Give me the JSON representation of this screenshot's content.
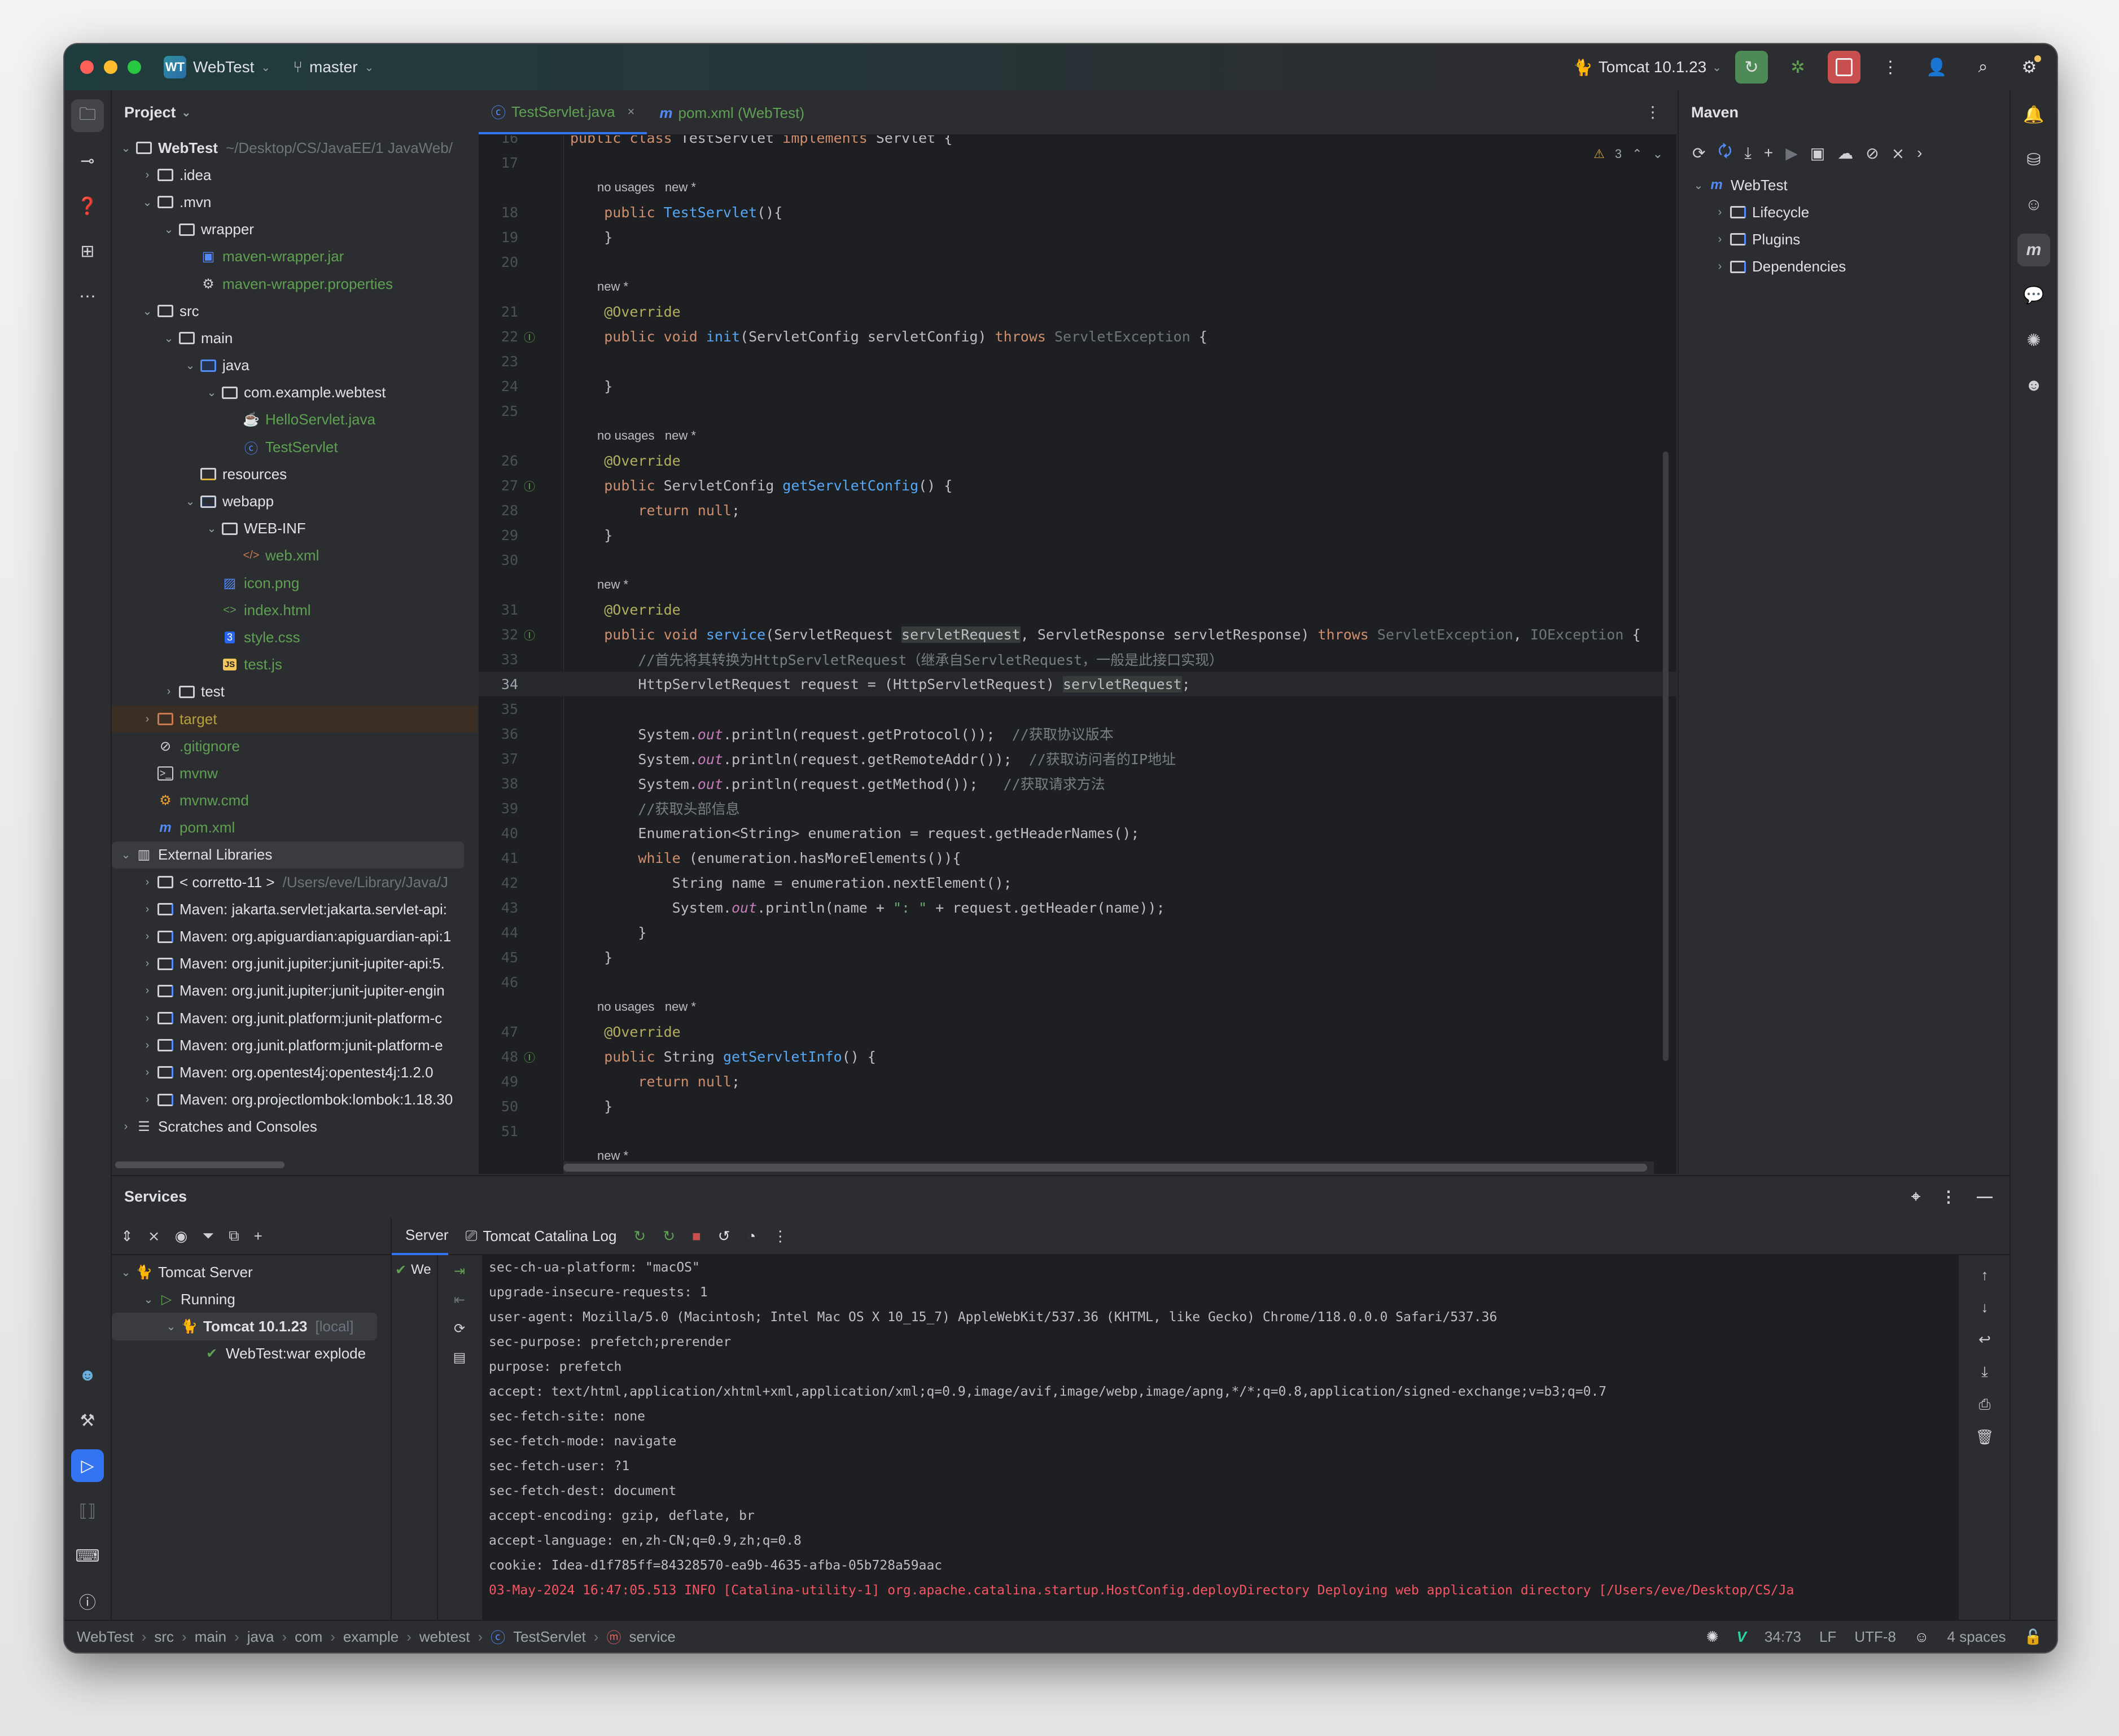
{
  "titlebar": {
    "project_badge": "WT",
    "project_name": "WebTest",
    "branch": "master",
    "run_config": "Tomcat 10.1.23",
    "colors": {
      "close": "#ff5f57",
      "minimize": "#febc2e",
      "zoom": "#28c840",
      "rerun_bg": "#4e8a56",
      "stop_bg": "#c94f4f"
    }
  },
  "project_panel": {
    "title": "Project",
    "tree": [
      {
        "label": "WebTest",
        "sub": "~/Desktop/CS/JavaEE/1 JavaWeb/",
        "depth": 0,
        "arrow": "v",
        "icon": "module-folder",
        "style": "bold"
      },
      {
        "label": ".idea",
        "depth": 1,
        "arrow": ">",
        "icon": "folder"
      },
      {
        "label": ".mvn",
        "depth": 1,
        "arrow": "v",
        "icon": "folder"
      },
      {
        "label": "wrapper",
        "depth": 2,
        "arrow": "v",
        "icon": "folder"
      },
      {
        "label": "maven-wrapper.jar",
        "depth": 3,
        "arrow": "",
        "icon": "jar",
        "style": "green"
      },
      {
        "label": "maven-wrapper.properties",
        "depth": 3,
        "arrow": "",
        "icon": "gear",
        "style": "green"
      },
      {
        "label": "src",
        "depth": 1,
        "arrow": "v",
        "icon": "folder"
      },
      {
        "label": "main",
        "depth": 2,
        "arrow": "v",
        "icon": "folder"
      },
      {
        "label": "java",
        "depth": 3,
        "arrow": "v",
        "icon": "source-folder"
      },
      {
        "label": "com.example.webtest",
        "depth": 4,
        "arrow": "v",
        "icon": "package"
      },
      {
        "label": "HelloServlet.java",
        "depth": 5,
        "arrow": "",
        "icon": "java-file",
        "style": "green"
      },
      {
        "label": "TestServlet",
        "depth": 5,
        "arrow": "",
        "icon": "class",
        "style": "green"
      },
      {
        "label": "resources",
        "depth": 3,
        "arrow": "",
        "icon": "resources-folder"
      },
      {
        "label": "webapp",
        "depth": 3,
        "arrow": "v",
        "icon": "web-folder"
      },
      {
        "label": "WEB-INF",
        "depth": 4,
        "arrow": "v",
        "icon": "folder"
      },
      {
        "label": "web.xml",
        "depth": 5,
        "arrow": "",
        "icon": "xml",
        "style": "green"
      },
      {
        "label": "icon.png",
        "depth": 4,
        "arrow": "",
        "icon": "image",
        "style": "green"
      },
      {
        "label": "index.html",
        "depth": 4,
        "arrow": "",
        "icon": "html",
        "style": "green"
      },
      {
        "label": "style.css",
        "depth": 4,
        "arrow": "",
        "icon": "css",
        "style": "green"
      },
      {
        "label": "test.js",
        "depth": 4,
        "arrow": "",
        "icon": "js",
        "style": "green"
      },
      {
        "label": "test",
        "depth": 2,
        "arrow": ">",
        "icon": "folder"
      },
      {
        "label": "target",
        "depth": 1,
        "arrow": ">",
        "icon": "excluded-folder",
        "style": "orange"
      },
      {
        "label": ".gitignore",
        "depth": 1,
        "arrow": "",
        "icon": "ignore",
        "style": "green"
      },
      {
        "label": "mvnw",
        "depth": 1,
        "arrow": "",
        "icon": "terminal",
        "style": "green"
      },
      {
        "label": "mvnw.cmd",
        "depth": 1,
        "arrow": "",
        "icon": "cmd",
        "style": "green"
      },
      {
        "label": "pom.xml",
        "depth": 1,
        "arrow": "",
        "icon": "maven",
        "style": "green"
      },
      {
        "label": "External Libraries",
        "depth": 0,
        "arrow": "v",
        "icon": "library",
        "style": "selected"
      },
      {
        "label": "< corretto-11 >",
        "sub": "/Users/eve/Library/Java/J",
        "depth": 1,
        "arrow": ">",
        "icon": "jdk"
      },
      {
        "label": "Maven: jakarta.servlet:jakarta.servlet-api:",
        "depth": 1,
        "arrow": ">",
        "icon": "lib-folder"
      },
      {
        "label": "Maven: org.apiguardian:apiguardian-api:1",
        "depth": 1,
        "arrow": ">",
        "icon": "lib-folder"
      },
      {
        "label": "Maven: org.junit.jupiter:junit-jupiter-api:5.",
        "depth": 1,
        "arrow": ">",
        "icon": "lib-folder"
      },
      {
        "label": "Maven: org.junit.jupiter:junit-jupiter-engin",
        "depth": 1,
        "arrow": ">",
        "icon": "lib-folder"
      },
      {
        "label": "Maven: org.junit.platform:junit-platform-c",
        "depth": 1,
        "arrow": ">",
        "icon": "lib-folder"
      },
      {
        "label": "Maven: org.junit.platform:junit-platform-e",
        "depth": 1,
        "arrow": ">",
        "icon": "lib-folder"
      },
      {
        "label": "Maven: org.opentest4j:opentest4j:1.2.0",
        "depth": 1,
        "arrow": ">",
        "icon": "lib-folder"
      },
      {
        "label": "Maven: org.projectlombok:lombok:1.18.30",
        "depth": 1,
        "arrow": ">",
        "icon": "lib-folder"
      },
      {
        "label": "Scratches and Consoles",
        "depth": 0,
        "arrow": ">",
        "icon": "scratches"
      }
    ]
  },
  "editor": {
    "tabs": [
      {
        "label": "TestServlet.java",
        "icon": "class",
        "active": true
      },
      {
        "label": "pom.xml (WebTest)",
        "icon": "maven",
        "active": false
      }
    ],
    "inspection": {
      "warnings": "3"
    },
    "lines": [
      {
        "n": "16",
        "segs": [
          [
            "kw",
            "public class "
          ],
          [
            "",
            "TestServlet "
          ],
          [
            "kw",
            "implements "
          ],
          [
            "",
            "Servlet {"
          ]
        ]
      },
      {
        "n": "17",
        "segs": []
      },
      {
        "hint": "no usages   new *"
      },
      {
        "n": "18",
        "segs": [
          [
            "",
            "    "
          ],
          [
            "kw",
            "public "
          ],
          [
            "fn",
            "TestServlet"
          ],
          [
            "",
            "(){"
          ]
        ]
      },
      {
        "n": "19",
        "segs": [
          [
            "",
            "    }"
          ]
        ]
      },
      {
        "n": "20",
        "segs": []
      },
      {
        "hint": "new *"
      },
      {
        "n": "21",
        "segs": [
          [
            "",
            "    "
          ],
          [
            "an",
            "@Override"
          ]
        ]
      },
      {
        "n": "22",
        "gi": "I↑",
        "segs": [
          [
            "",
            "    "
          ],
          [
            "kw",
            "public void "
          ],
          [
            "fn",
            "init"
          ],
          [
            "",
            "(ServletConfig servletConfig) "
          ],
          [
            "kw",
            "throws "
          ],
          [
            "dim",
            "ServletException"
          ],
          [
            "",
            " {"
          ]
        ]
      },
      {
        "n": "23",
        "segs": []
      },
      {
        "n": "24",
        "segs": [
          [
            "",
            "    }"
          ]
        ]
      },
      {
        "n": "25",
        "segs": []
      },
      {
        "hint": "no usages   new *"
      },
      {
        "n": "26",
        "segs": [
          [
            "",
            "    "
          ],
          [
            "an",
            "@Override"
          ]
        ]
      },
      {
        "n": "27",
        "gi": "I↑",
        "segs": [
          [
            "",
            "    "
          ],
          [
            "kw",
            "public "
          ],
          [
            "",
            "ServletConfig "
          ],
          [
            "fn",
            "getServletConfig"
          ],
          [
            "",
            "() {"
          ]
        ]
      },
      {
        "n": "28",
        "segs": [
          [
            "",
            "        "
          ],
          [
            "kw",
            "return null"
          ],
          [
            "",
            ";"
          ]
        ]
      },
      {
        "n": "29",
        "segs": [
          [
            "",
            "    }"
          ]
        ]
      },
      {
        "n": "30",
        "segs": []
      },
      {
        "hint": "new *"
      },
      {
        "n": "31",
        "segs": [
          [
            "",
            "    "
          ],
          [
            "an",
            "@Override"
          ]
        ]
      },
      {
        "n": "32",
        "gi": "I↑",
        "segs": [
          [
            "",
            "    "
          ],
          [
            "kw",
            "public void "
          ],
          [
            "fn",
            "service"
          ],
          [
            "",
            "(ServletRequest "
          ],
          [
            "hl",
            "servletRequest"
          ],
          [
            "",
            ", ServletResponse servletResponse) "
          ],
          [
            "kw",
            "throws "
          ],
          [
            "dim",
            "ServletException"
          ],
          [
            "",
            ", "
          ],
          [
            "dim",
            "IOException"
          ],
          [
            "",
            " {"
          ]
        ]
      },
      {
        "n": "33",
        "segs": [
          [
            "",
            "        "
          ],
          [
            "cm",
            "//首先将其转换为HttpServletRequest（继承自ServletRequest，一般是此接口实现）"
          ]
        ]
      },
      {
        "n": "34",
        "cur": true,
        "segs": [
          [
            "",
            "        HttpServletRequest request = (HttpServletRequest) "
          ],
          [
            "hl",
            "servletRequest"
          ],
          [
            "",
            ";"
          ]
        ]
      },
      {
        "n": "35",
        "segs": []
      },
      {
        "n": "36",
        "segs": [
          [
            "",
            "        System."
          ],
          [
            "fld",
            "out"
          ],
          [
            "",
            ".println(request.getProtocol());  "
          ],
          [
            "cm",
            "//获取协议版本"
          ]
        ]
      },
      {
        "n": "37",
        "segs": [
          [
            "",
            "        System."
          ],
          [
            "fld",
            "out"
          ],
          [
            "",
            ".println(request.getRemoteAddr());  "
          ],
          [
            "cm",
            "//获取访问者的IP地址"
          ]
        ]
      },
      {
        "n": "38",
        "segs": [
          [
            "",
            "        System."
          ],
          [
            "fld",
            "out"
          ],
          [
            "",
            ".println(request.getMethod());   "
          ],
          [
            "cm",
            "//获取请求方法"
          ]
        ]
      },
      {
        "n": "39",
        "segs": [
          [
            "",
            "        "
          ],
          [
            "cm",
            "//获取头部信息"
          ]
        ]
      },
      {
        "n": "40",
        "segs": [
          [
            "",
            "        Enumeration<String> enumeration = request.getHeaderNames();"
          ]
        ]
      },
      {
        "n": "41",
        "segs": [
          [
            "",
            "        "
          ],
          [
            "kw",
            "while "
          ],
          [
            "",
            "(enumeration.hasMoreElements()){"
          ]
        ]
      },
      {
        "n": "42",
        "segs": [
          [
            "",
            "            String name = enumeration.nextElement();"
          ]
        ]
      },
      {
        "n": "43",
        "segs": [
          [
            "",
            "            System."
          ],
          [
            "fld",
            "out"
          ],
          [
            "",
            ".println(name + "
          ],
          [
            "st",
            "\": \""
          ],
          [
            "",
            " + request.getHeader(name));"
          ]
        ]
      },
      {
        "n": "44",
        "segs": [
          [
            "",
            "        }"
          ]
        ]
      },
      {
        "n": "45",
        "segs": [
          [
            "",
            "    }"
          ]
        ]
      },
      {
        "n": "46",
        "segs": []
      },
      {
        "hint": "no usages   new *"
      },
      {
        "n": "47",
        "segs": [
          [
            "",
            "    "
          ],
          [
            "an",
            "@Override"
          ]
        ]
      },
      {
        "n": "48",
        "gi": "I↑",
        "segs": [
          [
            "",
            "    "
          ],
          [
            "kw",
            "public "
          ],
          [
            "",
            "String "
          ],
          [
            "fn",
            "getServletInfo"
          ],
          [
            "",
            "() {"
          ]
        ]
      },
      {
        "n": "49",
        "segs": [
          [
            "",
            "        "
          ],
          [
            "kw",
            "return null"
          ],
          [
            "",
            ";"
          ]
        ]
      },
      {
        "n": "50",
        "segs": [
          [
            "",
            "    }"
          ]
        ]
      },
      {
        "n": "51",
        "segs": []
      },
      {
        "hint": "new *"
      }
    ]
  },
  "maven_panel": {
    "title": "Maven",
    "toolbar": [
      "reload-icon",
      "reload-folder-icon",
      "download-icon",
      "add-icon",
      "run-icon",
      "execute-goal-icon",
      "offline-icon",
      "skip-tests-icon",
      "collapse-icon",
      "more-icon"
    ],
    "tree": [
      {
        "label": "WebTest",
        "depth": 0,
        "arrow": "v",
        "icon": "maven"
      },
      {
        "label": "Lifecycle",
        "depth": 1,
        "arrow": ">",
        "icon": "gear-folder"
      },
      {
        "label": "Plugins",
        "depth": 1,
        "arrow": ">",
        "icon": "gear-folder"
      },
      {
        "label": "Dependencies",
        "depth": 1,
        "arrow": ">",
        "icon": "lib-folder"
      }
    ]
  },
  "services": {
    "title": "Services",
    "tree": [
      {
        "label": "Tomcat Server",
        "depth": 0,
        "arrow": "v",
        "icon": "tomcat"
      },
      {
        "label": "Running",
        "depth": 1,
        "arrow": "v",
        "icon": "run"
      },
      {
        "label": "Tomcat 10.1.23",
        "sub": "[local]",
        "depth": 2,
        "arrow": "v",
        "icon": "tomcat",
        "selected": true
      },
      {
        "label": "WebTest:war explode",
        "depth": 3,
        "arrow": "",
        "icon": "artifact-check"
      }
    ],
    "tabs": [
      {
        "label": "Server",
        "active": true
      },
      {
        "label": "Tomcat Catalina Log",
        "active": false
      }
    ],
    "deployment_label": "We",
    "console": [
      "sec-ch-ua-platform: \"macOS\"",
      "upgrade-insecure-requests: 1",
      "user-agent: Mozilla/5.0 (Macintosh; Intel Mac OS X 10_15_7) AppleWebKit/537.36 (KHTML, like Gecko) Chrome/118.0.0.0 Safari/537.36",
      "sec-purpose: prefetch;prerender",
      "purpose: prefetch",
      "accept: text/html,application/xhtml+xml,application/xml;q=0.9,image/avif,image/webp,image/apng,*/*;q=0.8,application/signed-exchange;v=b3;q=0.7",
      "sec-fetch-site: none",
      "sec-fetch-mode: navigate",
      "sec-fetch-user: ?1",
      "sec-fetch-dest: document",
      "accept-encoding: gzip, deflate, br",
      "accept-language: en,zh-CN;q=0.9,zh;q=0.8",
      "cookie: Idea-d1f785ff=84328570-ea9b-4635-afba-05b728a59aac"
    ],
    "console_error": "03-May-2024 16:47:05.513 INFO [Catalina-utility-1] org.apache.catalina.startup.HostConfig.deployDirectory Deploying web application directory [/Users/eve/Desktop/CS/Ja"
  },
  "statusbar": {
    "breadcrumbs": [
      "WebTest",
      "src",
      "main",
      "java",
      "com",
      "example",
      "webtest",
      "TestServlet",
      "service"
    ],
    "position": "34:73",
    "line_sep": "LF",
    "encoding": "UTF-8",
    "indent": "4 spaces"
  }
}
